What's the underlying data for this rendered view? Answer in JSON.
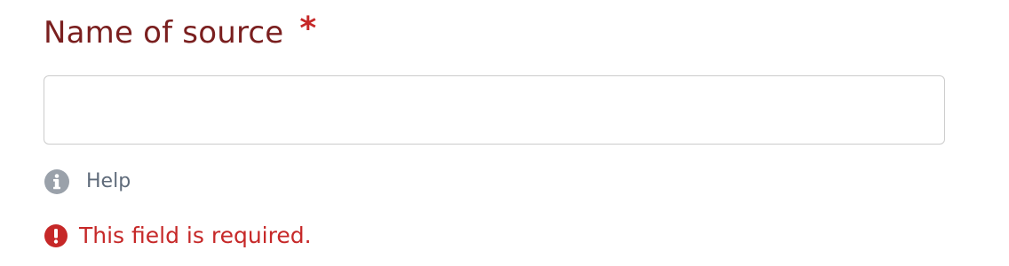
{
  "field": {
    "label": "Name of source",
    "required_marker": "*",
    "input_value": "",
    "input_placeholder": "",
    "help_label": "Help",
    "help_icon": "info-circle-icon",
    "error_icon": "exclamation-circle-icon",
    "error_message": "This field is required."
  },
  "colors": {
    "label": "#7a1f1f",
    "required": "#c62828",
    "error": "#c62828",
    "help_text": "#5f6b7a",
    "help_icon": "#9aa1aa",
    "input_border": "#cccccc"
  }
}
